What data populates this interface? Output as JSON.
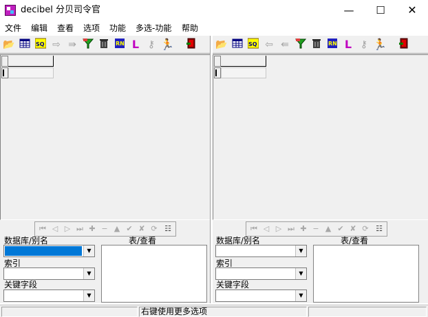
{
  "window": {
    "title": "decibel 分贝司令官",
    "minimize": "—",
    "maximize": "☐",
    "close": "✕"
  },
  "menu": [
    "文件",
    "编辑",
    "查看",
    "选项",
    "功能",
    "多选-功能",
    "帮助"
  ],
  "toolbar_icons": [
    "open-folder",
    "table",
    "sql",
    "arrow-right",
    "export",
    "filter",
    "trash",
    "query",
    "index",
    "key",
    "run",
    "exit"
  ],
  "left_panel": {
    "database_label": "数据库/别名",
    "table_label": "表/查看",
    "index_label": "索引",
    "keyfield_label": "关键字段"
  },
  "right_panel": {
    "database_label": "数据库/别名",
    "table_label": "表/查看",
    "index_label": "索引",
    "keyfield_label": "关键字段"
  },
  "status": {
    "hint": "右键使用更多选项"
  },
  "colors": {
    "selection": "#0078d7",
    "chrome": "#f0f0f0"
  }
}
